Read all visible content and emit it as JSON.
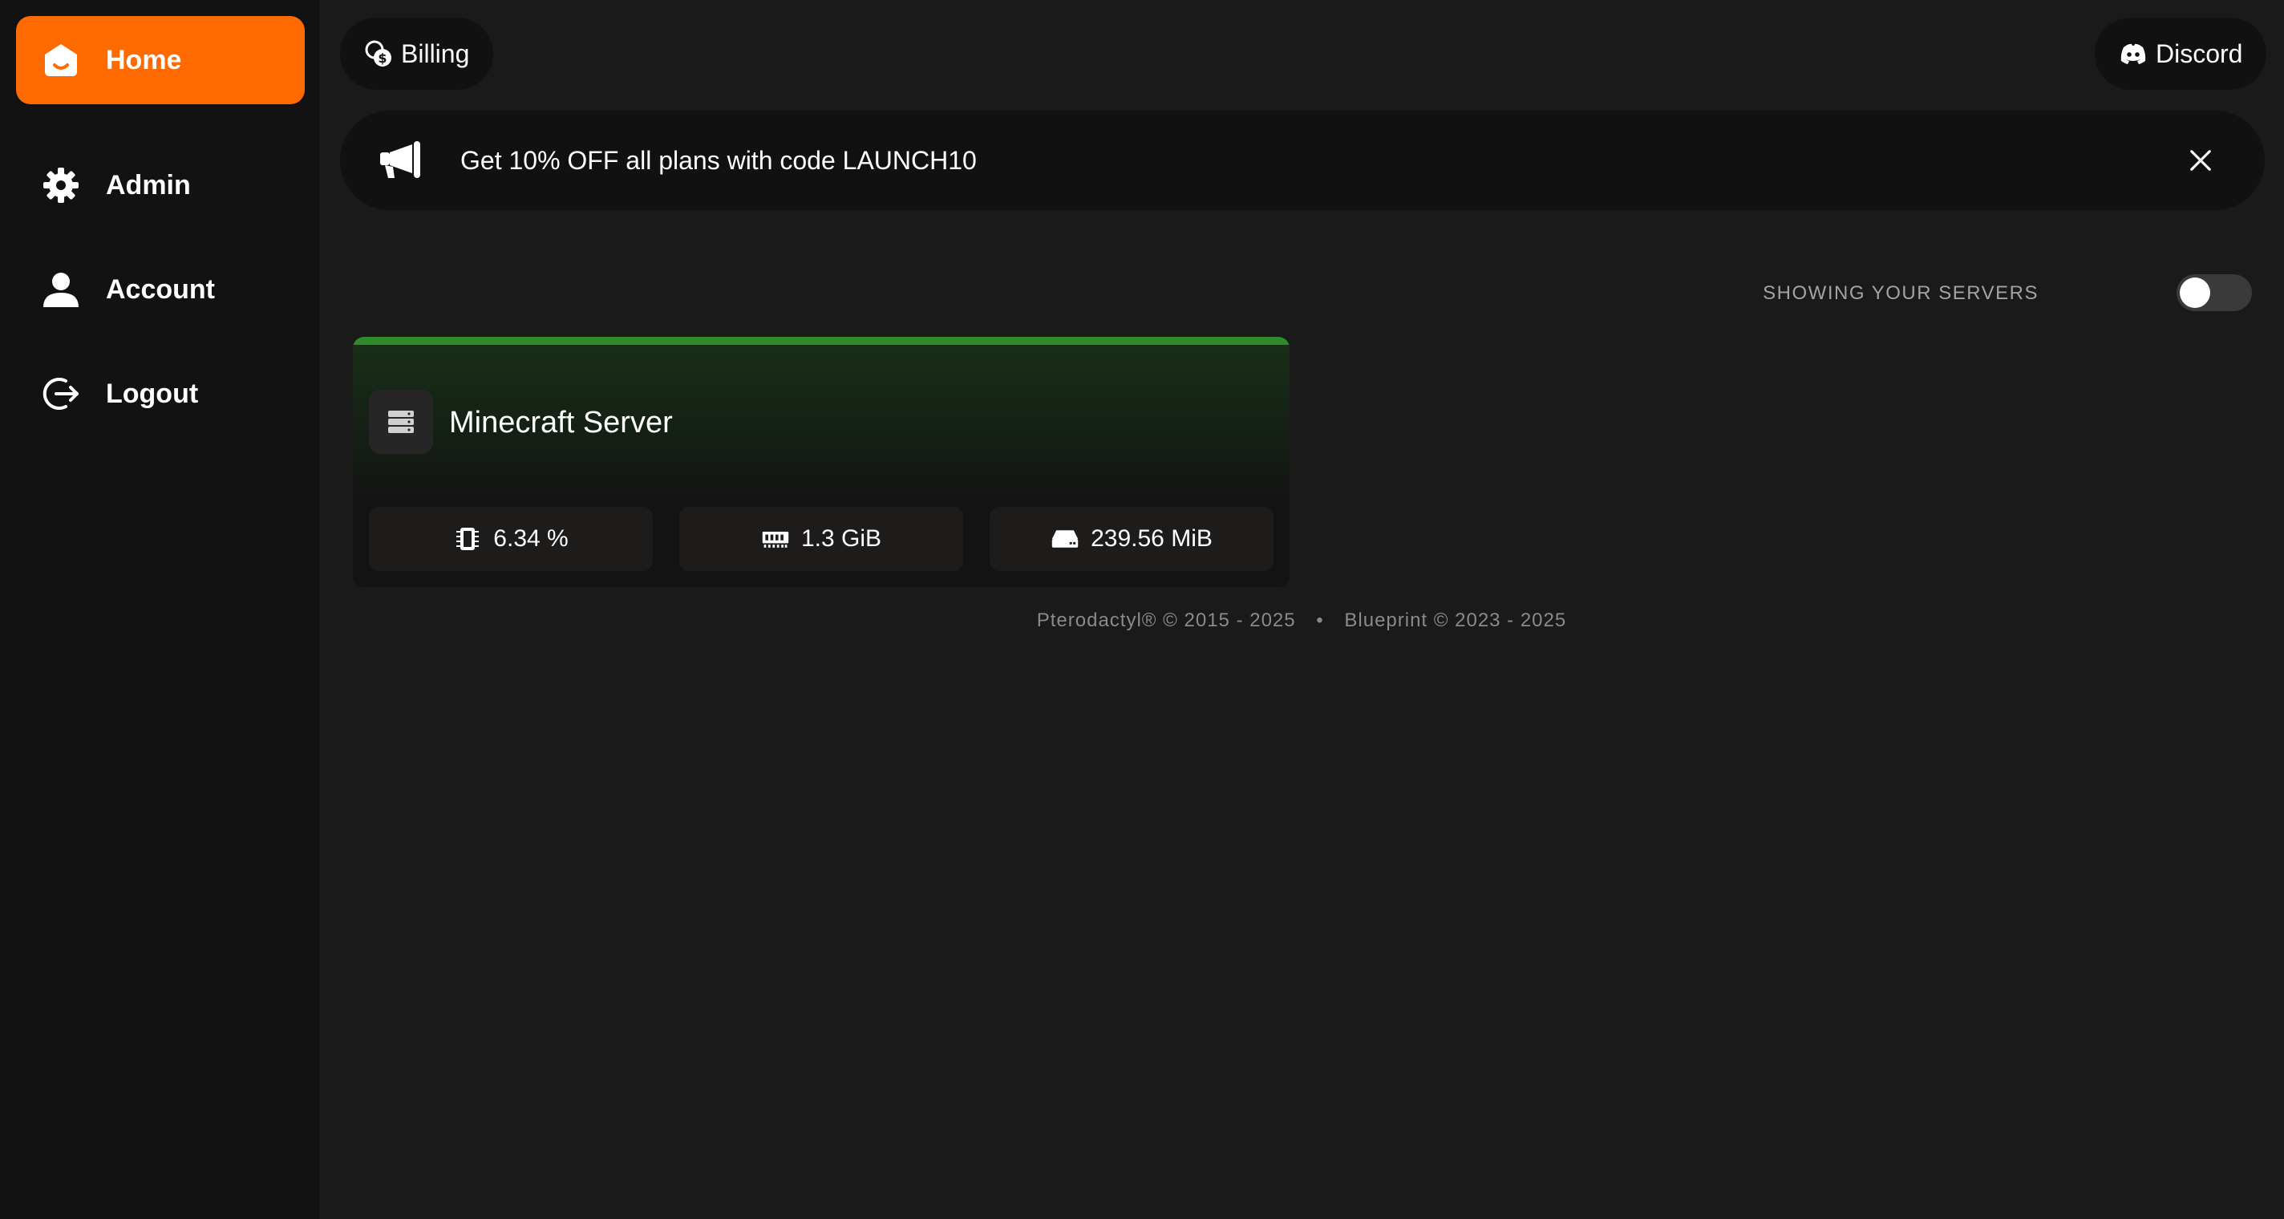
{
  "sidebar": {
    "items": [
      {
        "label": "Home",
        "icon": "home-icon",
        "active": true
      },
      {
        "label": "Admin",
        "icon": "gear-icon",
        "active": false
      },
      {
        "label": "Account",
        "icon": "user-icon",
        "active": false
      },
      {
        "label": "Logout",
        "icon": "logout-icon",
        "active": false
      }
    ]
  },
  "header": {
    "billing_label": "Billing",
    "discord_label": "Discord"
  },
  "announcement": {
    "text": "Get 10% OFF all plans with code LAUNCH10"
  },
  "filter": {
    "label": "SHOWING YOUR SERVERS",
    "toggle_on": false
  },
  "servers": [
    {
      "name": "Minecraft Server",
      "status_color": "#2f8a2a",
      "cpu": "6.34 %",
      "memory": "1.3 GiB",
      "disk": "239.56 MiB"
    }
  ],
  "footer": {
    "pterodactyl": "Pterodactyl® © 2015 - 2025",
    "separator": "•",
    "blueprint": "Blueprint © 2023 - 2025"
  },
  "colors": {
    "accent": "#ff6b00",
    "background": "#1a1a1a",
    "sidebar": "#121212",
    "online": "#2f8a2a"
  }
}
